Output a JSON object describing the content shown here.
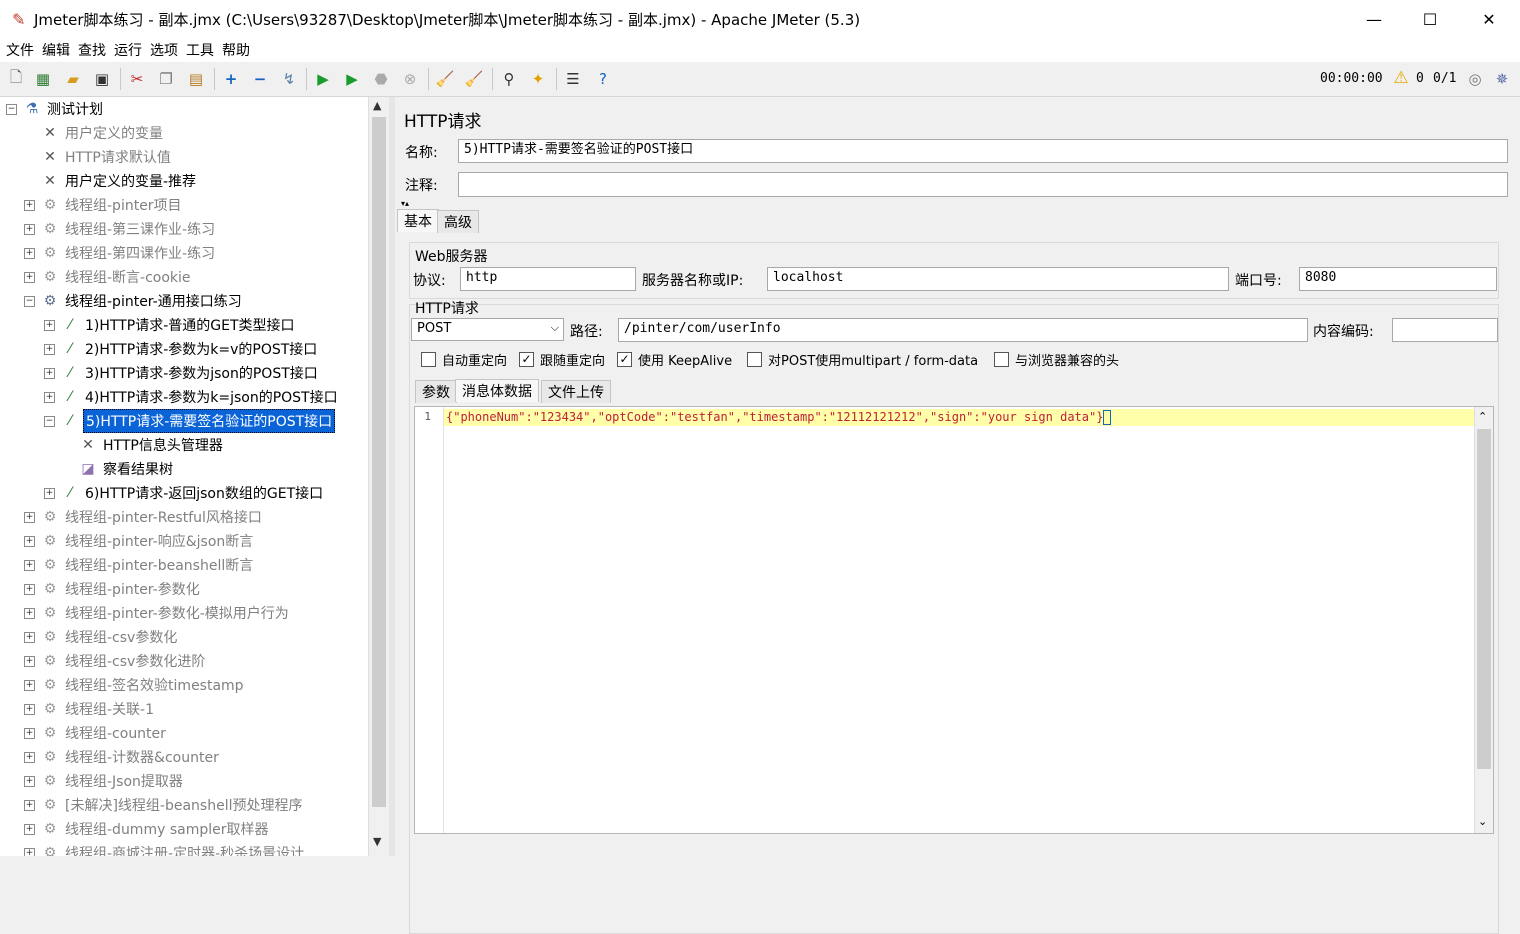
{
  "window": {
    "title": "Jmeter脚本练习 - 副本.jmx (C:\\Users\\93287\\Desktop\\Jmeter脚本\\Jmeter脚本练习 - 副本.jmx) - Apache JMeter (5.3)",
    "minimize": "—",
    "maximize": "☐",
    "close": "✕"
  },
  "menu": [
    "文件",
    "编辑",
    "查找",
    "运行",
    "选项",
    "工具",
    "帮助"
  ],
  "toolbar": {
    "timer": "00:00:00",
    "warning_count": "0",
    "threads": "0/1"
  },
  "tree": {
    "nodes": [
      {
        "label": "测试计划",
        "icon": "flask-icon",
        "level": 0,
        "exp": "−",
        "disabled": false
      },
      {
        "label": "用户定义的变量",
        "icon": "tools-icon",
        "level": 1,
        "exp": "",
        "disabled": true
      },
      {
        "label": "HTTP请求默认值",
        "icon": "tools-icon",
        "level": 1,
        "exp": "",
        "disabled": true
      },
      {
        "label": "用户定义的变量-推荐",
        "icon": "tools-icon",
        "level": 1,
        "exp": "",
        "disabled": false
      },
      {
        "label": "线程组-pinter项目",
        "icon": "gear-icon",
        "level": 1,
        "exp": "+",
        "disabled": true
      },
      {
        "label": "线程组-第三课作业-练习",
        "icon": "gear-icon",
        "level": 1,
        "exp": "+",
        "disabled": true
      },
      {
        "label": "线程组-第四课作业-练习",
        "icon": "gear-icon",
        "level": 1,
        "exp": "+",
        "disabled": true
      },
      {
        "label": "线程组-断言-cookie",
        "icon": "gear-icon",
        "level": 1,
        "exp": "+",
        "disabled": true
      },
      {
        "label": "线程组-pinter-通用接口练习",
        "icon": "gear-icon",
        "level": 1,
        "exp": "−",
        "disabled": false
      },
      {
        "label": "1)HTTP请求-普通的GET类型接口",
        "icon": "pipette-icon",
        "level": 2,
        "exp": "+",
        "disabled": false
      },
      {
        "label": "2)HTTP请求-参数为k=v的POST接口",
        "icon": "pipette-icon",
        "level": 2,
        "exp": "+",
        "disabled": false
      },
      {
        "label": "3)HTTP请求-参数为json的POST接口",
        "icon": "pipette-icon",
        "level": 2,
        "exp": "+",
        "disabled": false
      },
      {
        "label": "4)HTTP请求-参数为k=json的POST接口",
        "icon": "pipette-icon",
        "level": 2,
        "exp": "+",
        "disabled": false
      },
      {
        "label": "5)HTTP请求-需要签名验证的POST接口",
        "icon": "pipette-icon",
        "level": 2,
        "exp": "−",
        "disabled": false,
        "selected": true
      },
      {
        "label": "HTTP信息头管理器",
        "icon": "tools-icon",
        "level": 3,
        "exp": "",
        "disabled": false
      },
      {
        "label": "察看结果树",
        "icon": "chart-icon",
        "level": 3,
        "exp": "",
        "disabled": false
      },
      {
        "label": "6)HTTP请求-返回json数组的GET接口",
        "icon": "pipette-icon",
        "level": 2,
        "exp": "+",
        "disabled": false
      },
      {
        "label": "线程组-pinter-Restful风格接口",
        "icon": "gear-icon",
        "level": 1,
        "exp": "+",
        "disabled": true
      },
      {
        "label": "线程组-pinter-响应&json断言",
        "icon": "gear-icon",
        "level": 1,
        "exp": "+",
        "disabled": true
      },
      {
        "label": "线程组-pinter-beanshell断言",
        "icon": "gear-icon",
        "level": 1,
        "exp": "+",
        "disabled": true
      },
      {
        "label": "线程组-pinter-参数化",
        "icon": "gear-icon",
        "level": 1,
        "exp": "+",
        "disabled": true
      },
      {
        "label": "线程组-pinter-参数化-模拟用户行为",
        "icon": "gear-icon",
        "level": 1,
        "exp": "+",
        "disabled": true
      },
      {
        "label": "线程组-csv参数化",
        "icon": "gear-icon",
        "level": 1,
        "exp": "+",
        "disabled": true
      },
      {
        "label": "线程组-csv参数化进阶",
        "icon": "gear-icon",
        "level": 1,
        "exp": "+",
        "disabled": true
      },
      {
        "label": "线程组-签名效验timestamp",
        "icon": "gear-icon",
        "level": 1,
        "exp": "+",
        "disabled": true
      },
      {
        "label": "线程组-关联-1",
        "icon": "gear-icon",
        "level": 1,
        "exp": "+",
        "disabled": true
      },
      {
        "label": "线程组-counter",
        "icon": "gear-icon",
        "level": 1,
        "exp": "+",
        "disabled": true
      },
      {
        "label": "线程组-计数器&counter",
        "icon": "gear-icon",
        "level": 1,
        "exp": "+",
        "disabled": true
      },
      {
        "label": "线程组-Json提取器",
        "icon": "gear-icon",
        "level": 1,
        "exp": "+",
        "disabled": true
      },
      {
        "label": "[未解决]线程组-beanshell预处理程序",
        "icon": "gear-icon",
        "level": 1,
        "exp": "+",
        "disabled": true
      },
      {
        "label": "线程组-dummy sampler取样器",
        "icon": "gear-icon",
        "level": 1,
        "exp": "+",
        "disabled": true
      },
      {
        "label": "线程组-商城注册-定时器-秒杀场景设计",
        "icon": "gear-icon",
        "level": 1,
        "exp": "+",
        "disabled": true
      }
    ]
  },
  "panel": {
    "heading": "HTTP请求",
    "name_label": "名称:",
    "name_value": "5)HTTP请求-需要签名验证的POST接口",
    "comment_label": "注释:",
    "comment_value": "",
    "tabs": [
      "基本",
      "高级"
    ],
    "web_server": {
      "section": "Web服务器",
      "protocol_label": "协议:",
      "protocol_value": "http",
      "server_label": "服务器名称或IP:",
      "server_value": "localhost",
      "port_label": "端口号:",
      "port_value": "8080"
    },
    "http_request": {
      "section": "HTTP请求",
      "method": "POST",
      "path_label": "路径:",
      "path_value": "/pinter/com/userInfo",
      "encoding_label": "内容编码:",
      "encoding_value": ""
    },
    "options": [
      {
        "label": "自动重定向",
        "checked": false
      },
      {
        "label": "跟随重定向",
        "checked": true
      },
      {
        "label": "使用 KeepAlive",
        "checked": true
      },
      {
        "label": "对POST使用multipart / form-data",
        "checked": false
      },
      {
        "label": "与浏览器兼容的头",
        "checked": false
      }
    ],
    "subtabs": [
      "参数",
      "消息体数据",
      "文件上传"
    ],
    "body": {
      "line_number": "1",
      "content": "{\"phoneNum\":\"123434\",\"optCode\":\"testfan\",\"timestamp\":\"12112121212\",\"sign\":\"your sign data\"}"
    }
  }
}
